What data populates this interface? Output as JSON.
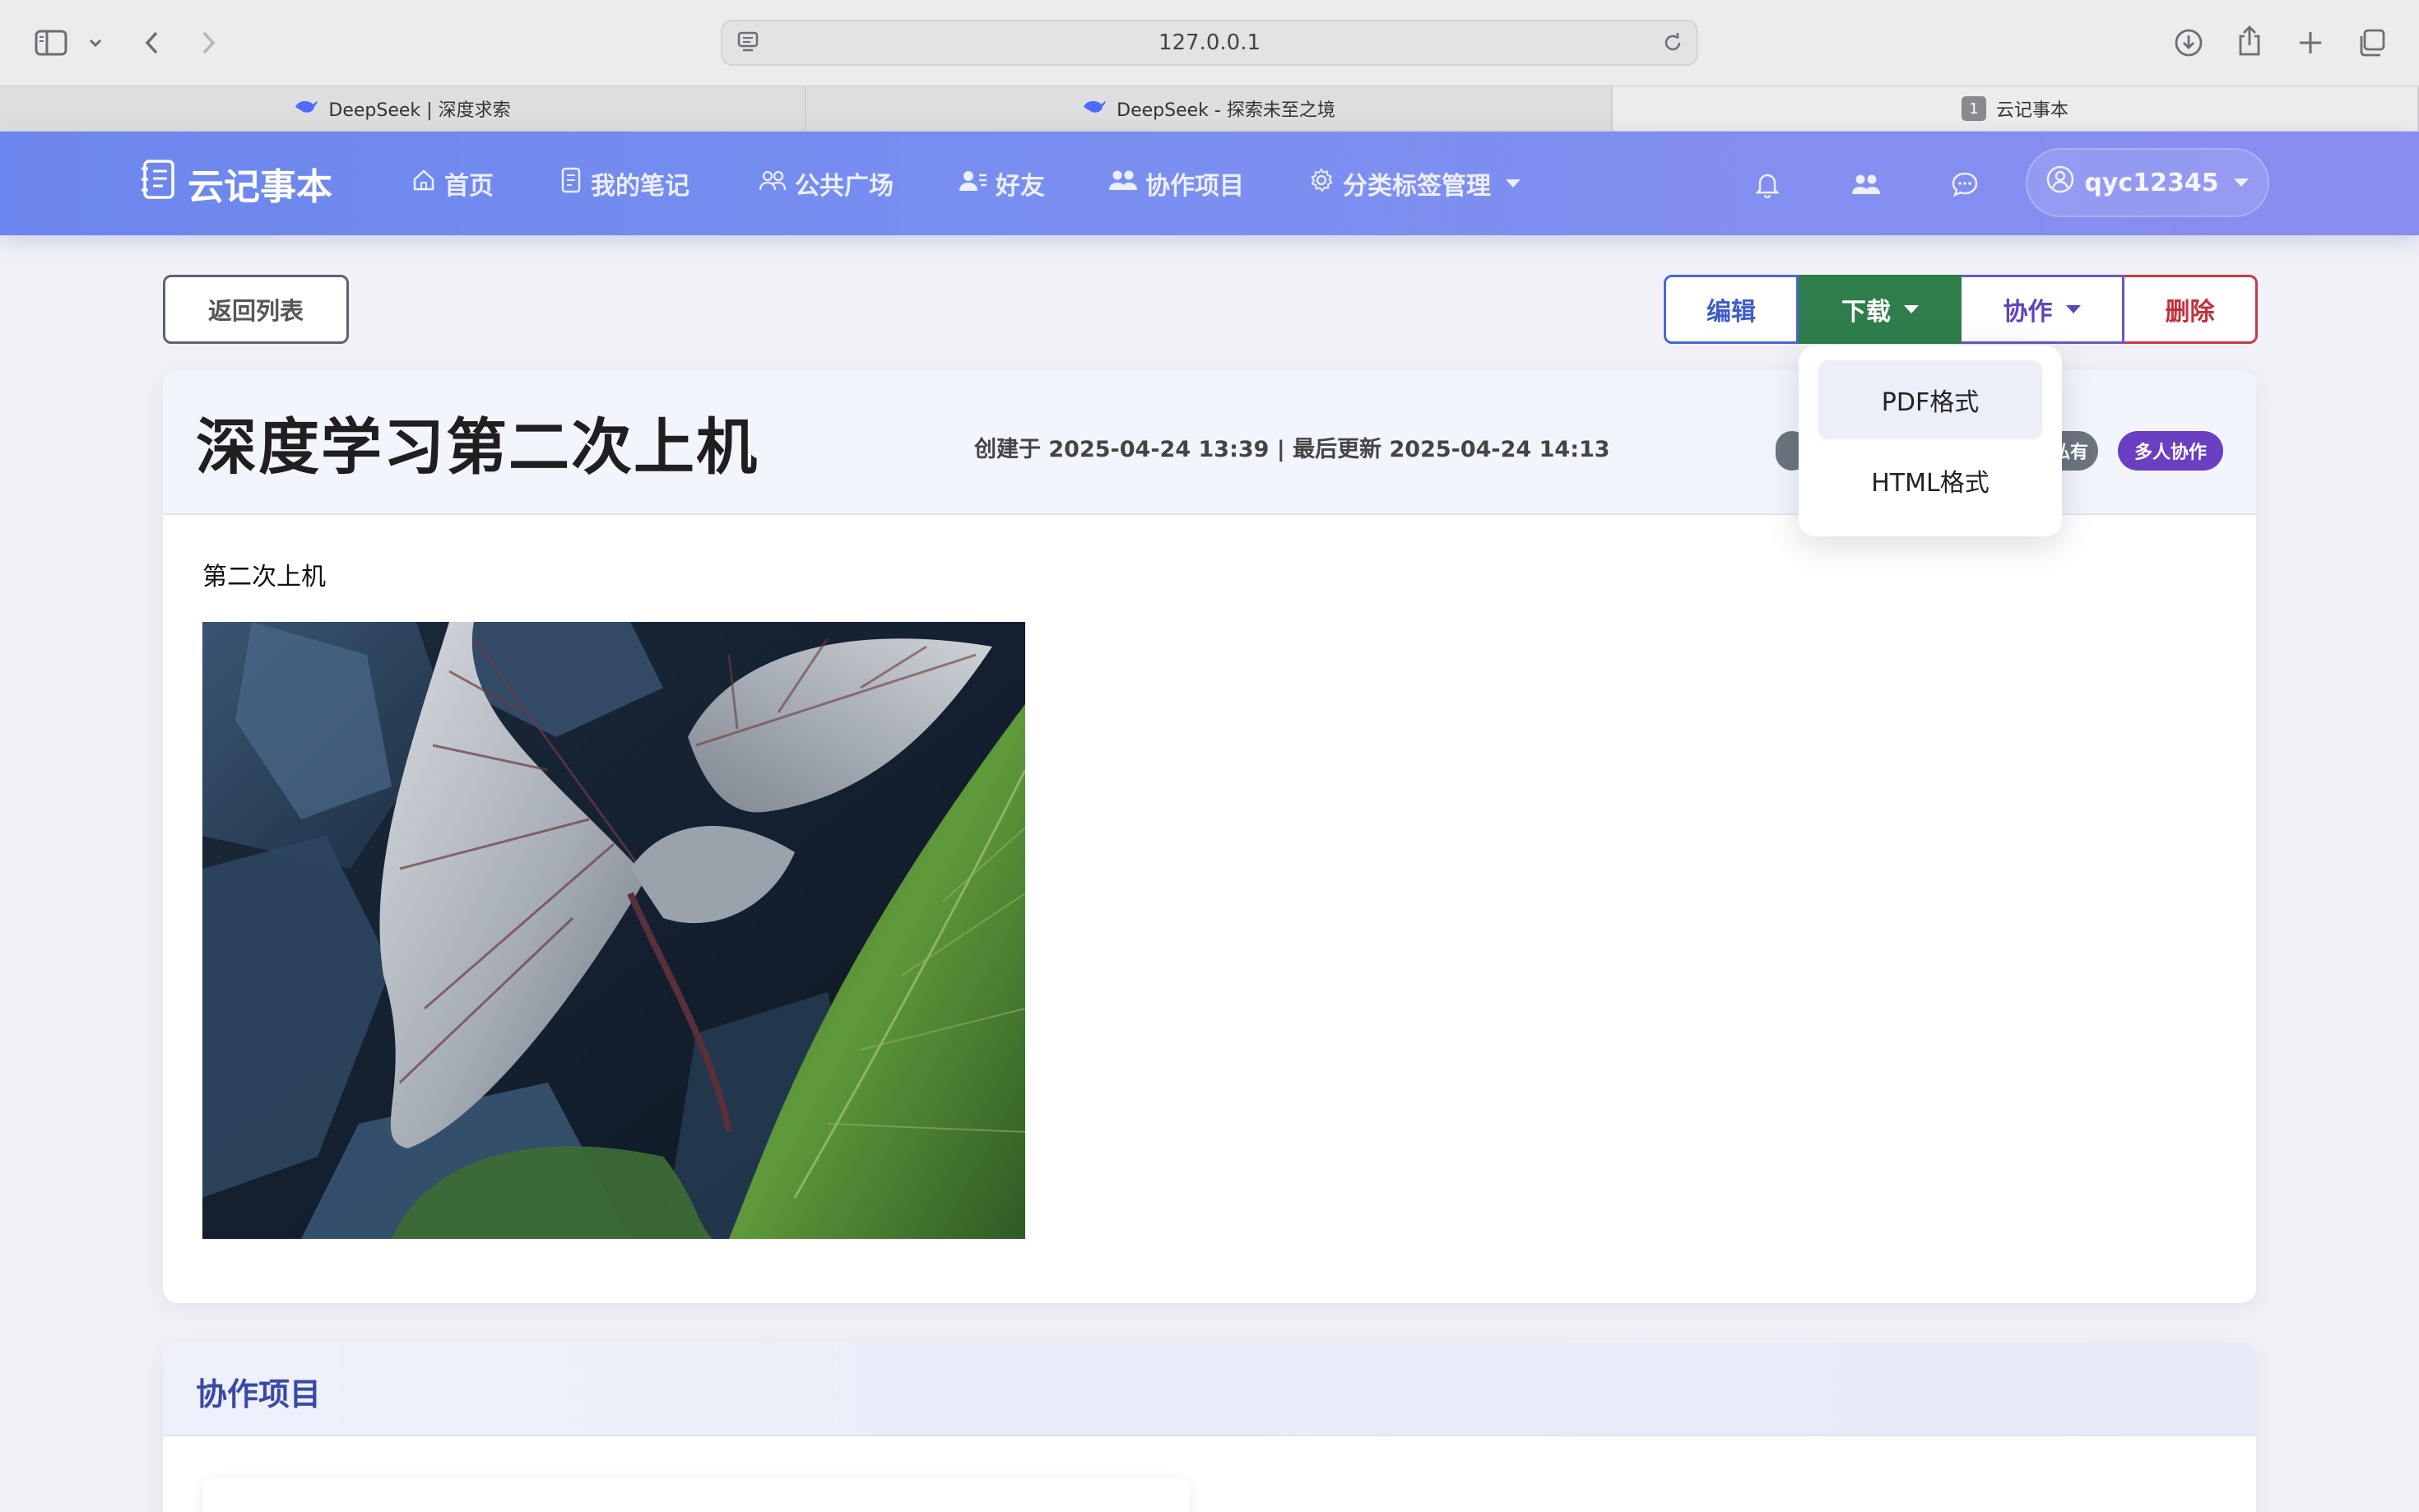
{
  "browser": {
    "url": "127.0.0.1",
    "tabs": [
      {
        "title": "DeepSeek | 深度求索",
        "active": false
      },
      {
        "title": "DeepSeek - 探索未至之境",
        "active": false
      },
      {
        "title": "云记事本",
        "badge": "1",
        "active": true
      }
    ]
  },
  "navbar": {
    "brand": "云记事本",
    "items": [
      {
        "label": "首页",
        "icon": "home-icon"
      },
      {
        "label": "我的笔记",
        "icon": "note-icon"
      },
      {
        "label": "公共广场",
        "icon": "people-icon"
      },
      {
        "label": "好友",
        "icon": "friend-icon"
      },
      {
        "label": "协作项目",
        "icon": "team-icon"
      },
      {
        "label": "分类标签管理",
        "icon": "gear-icon"
      }
    ],
    "user": "qyc12345"
  },
  "actions": {
    "back": "返回列表",
    "edit": "编辑",
    "download": "下载",
    "collab": "协作",
    "delete": "删除"
  },
  "dropdown": {
    "items": [
      "PDF格式",
      "HTML格式"
    ]
  },
  "note": {
    "title": "深度学习第二次上机",
    "meta": "创建于 2025-04-24 13:39 | 最后更新 2025-04-24 14:13",
    "tags": [
      "私有",
      "多人协作"
    ],
    "body": "第二次上机"
  },
  "collab_section": {
    "title": "协作项目"
  }
}
